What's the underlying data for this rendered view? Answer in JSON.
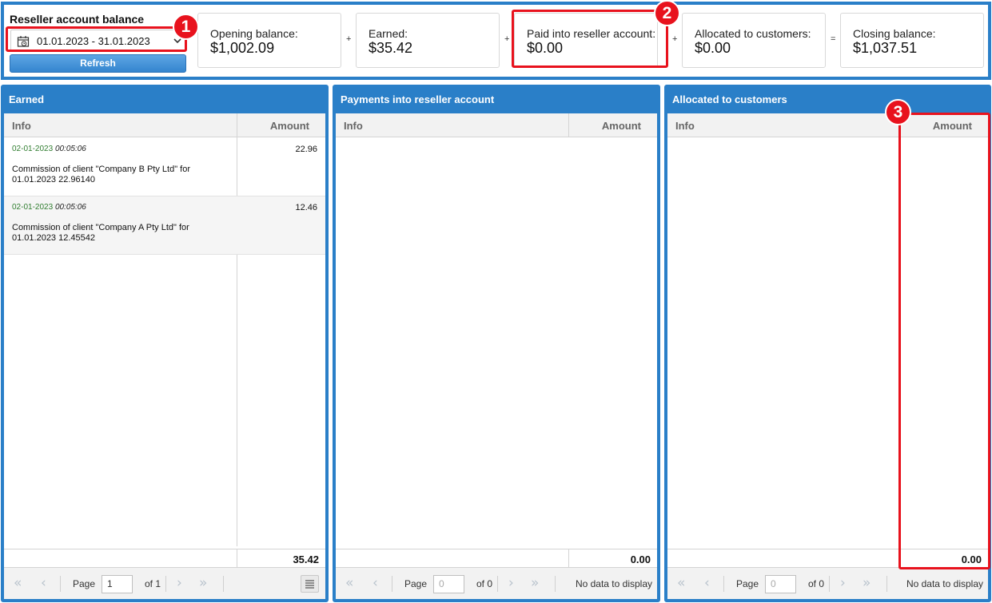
{
  "summary": {
    "title": "Reseller account balance",
    "date_range": "01.01.2023 - 31.01.2023",
    "refresh_label": "Refresh",
    "cards": [
      {
        "label": "Opening balance:",
        "value": "$1,002.09"
      },
      {
        "label": "Earned:",
        "value": "$35.42"
      },
      {
        "label": "Paid into reseller account:",
        "value": "$0.00"
      },
      {
        "label": "Allocated to customers:",
        "value": "$0.00"
      },
      {
        "label": "Closing balance:",
        "value": "$1,037.51"
      }
    ],
    "operators": [
      "+",
      "+",
      "+",
      "="
    ]
  },
  "panels": [
    {
      "title": "Earned",
      "col_info": "Info",
      "col_amount": "Amount",
      "rows": [
        {
          "date": "02-01-2023",
          "time": "00:05:06",
          "description": "Commission of client \"Company B Pty Ltd\" for 01.01.2023 22.96140",
          "amount": "22.96"
        },
        {
          "date": "02-01-2023",
          "time": "00:05:06",
          "description": "Commission of client \"Company A Pty Ltd\" for 01.01.2023 12.45542",
          "amount": "12.46"
        }
      ],
      "total": "35.42",
      "pager": {
        "page_label": "Page",
        "page_value": "1",
        "of_label": "of 1",
        "empty_text": ""
      }
    },
    {
      "title": "Payments into reseller account",
      "col_info": "Info",
      "col_amount": "Amount",
      "rows": [],
      "total": "0.00",
      "pager": {
        "page_label": "Page",
        "page_value": "0",
        "of_label": "of 0",
        "empty_text": "No data to display"
      }
    },
    {
      "title": "Allocated to customers",
      "col_info": "Info",
      "col_amount": "Amount",
      "rows": [],
      "total": "0.00",
      "pager": {
        "page_label": "Page",
        "page_value": "0",
        "of_label": "of 0",
        "empty_text": "No data to display"
      }
    }
  ],
  "annotations": {
    "badge_1": "1",
    "badge_2": "2",
    "badge_3": "3",
    "color": "#e8121d"
  },
  "colors": {
    "panel_header": "#2a7fc8",
    "date_text": "#2f7d2f"
  },
  "icons": {
    "date_picker": "calendar-clock-icon",
    "dropdown": "chevron-down-icon",
    "first": "double-chevron-left-icon",
    "prev": "chevron-left-icon",
    "next": "chevron-right-icon",
    "last": "double-chevron-right-icon",
    "menu": "menu-lines-icon"
  }
}
